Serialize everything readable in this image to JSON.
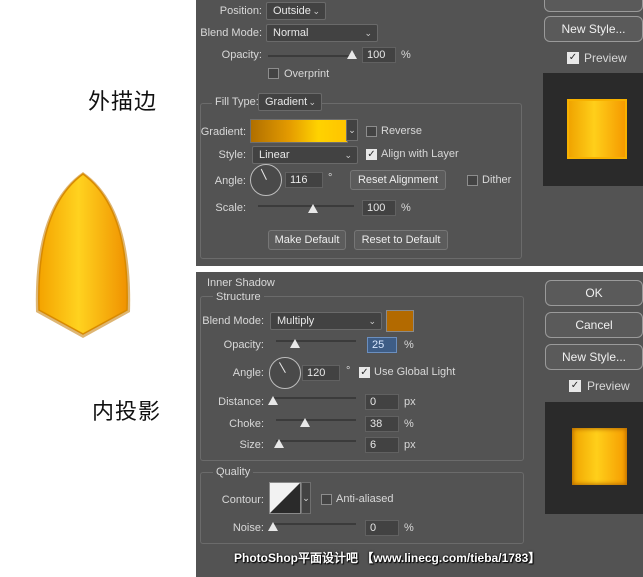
{
  "left": {
    "caption_stroke": "外描边",
    "caption_inner_shadow": "内投影"
  },
  "stroke": {
    "position_label": "Position:",
    "position_value": "Outside",
    "blend_label": "Blend Mode:",
    "blend_value": "Normal",
    "opacity_label": "Opacity:",
    "opacity_value": "100",
    "opacity_unit": "%",
    "opacity_level": 1.0,
    "overprint_label": "Overprint",
    "fill_type_label": "Fill Type:",
    "fill_type_value": "Gradient",
    "gradient_label": "Gradient:",
    "reverse_label": "Reverse",
    "style_label": "Style:",
    "style_value": "Linear",
    "align_label": "Align with Layer",
    "angle_label": "Angle:",
    "angle_value": "116",
    "angle_unit": "°",
    "reset_alignment": "Reset Alignment",
    "dither_label": "Dither",
    "scale_label": "Scale:",
    "scale_value": "100",
    "scale_unit": "%",
    "make_default": "Make Default",
    "reset_default": "Reset to Default"
  },
  "top_right": {
    "new_style": "New Style...",
    "preview_label": "Preview"
  },
  "inner_shadow": {
    "title": "Inner Shadow",
    "structure": "Structure",
    "blend_label": "Blend Mode:",
    "blend_value": "Multiply",
    "shadow_color": "#b36a00",
    "opacity_label": "Opacity:",
    "opacity_value": "25",
    "opacity_unit": "%",
    "angle_label": "Angle:",
    "angle_value": "120",
    "angle_unit": "°",
    "global_light": "Use Global Light",
    "distance_label": "Distance:",
    "distance_value": "0",
    "distance_unit": "px",
    "choke_label": "Choke:",
    "choke_value": "38",
    "choke_unit": "%",
    "size_label": "Size:",
    "size_value": "6",
    "size_unit": "px",
    "quality": "Quality",
    "contour_label": "Contour:",
    "anti_aliased": "Anti-aliased",
    "noise_label": "Noise:",
    "noise_value": "0",
    "noise_unit": "%"
  },
  "bottom_right": {
    "ok": "OK",
    "cancel": "Cancel",
    "new_style": "New Style...",
    "preview_label": "Preview"
  },
  "watermark": "PhotoShop平面设计吧 【www.linecg.com/tieba/1783】",
  "colors": {
    "panel": "#535353",
    "gold_light": "#ffcf1a",
    "gold_dark": "#e88f00",
    "shadow": "#b36a00"
  }
}
